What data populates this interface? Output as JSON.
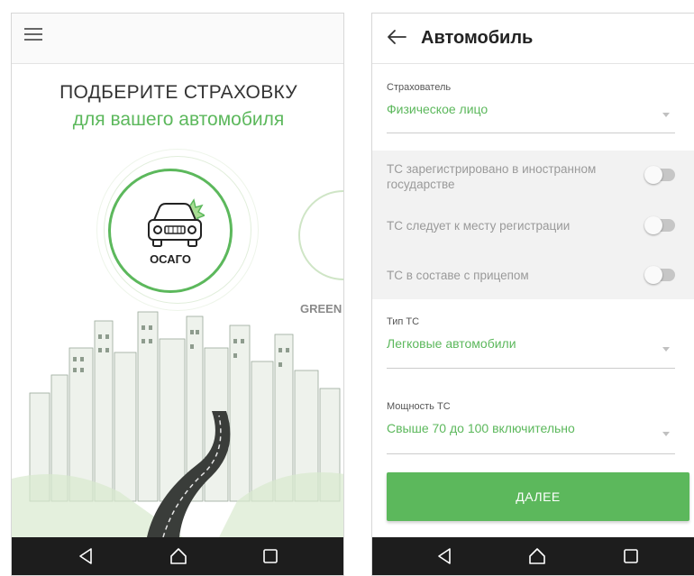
{
  "left_screen": {
    "title": "ПОДБЕРИТЕ СТРАХОВКУ",
    "subtitle": "для вашего автомобиля",
    "products": [
      {
        "label": "ОСАГО"
      },
      {
        "label": "GREEN"
      }
    ]
  },
  "right_screen": {
    "title": "Автомобиль",
    "insurer": {
      "label": "Страхователь",
      "value": "Физическое лицо"
    },
    "toggles": [
      {
        "label": "ТС зарегистрировано в иностранном государстве",
        "on": false
      },
      {
        "label": "ТС следует к месту регистрации",
        "on": false
      },
      {
        "label": "ТС в составе с прицепом",
        "on": false
      }
    ],
    "vehicle_type": {
      "label": "Тип ТС",
      "value": "Легковые автомобили"
    },
    "power": {
      "label": "Мощность ТС",
      "value": "Свыше 70 до 100 включительно"
    },
    "next_button": "ДАЛЕЕ"
  },
  "colors": {
    "accent": "#5cb85c",
    "navbar": "#1d1d1d"
  },
  "icons": [
    "menu-icon",
    "car-icon",
    "back-icon",
    "nav-back-icon",
    "nav-home-icon",
    "nav-recents-icon"
  ]
}
